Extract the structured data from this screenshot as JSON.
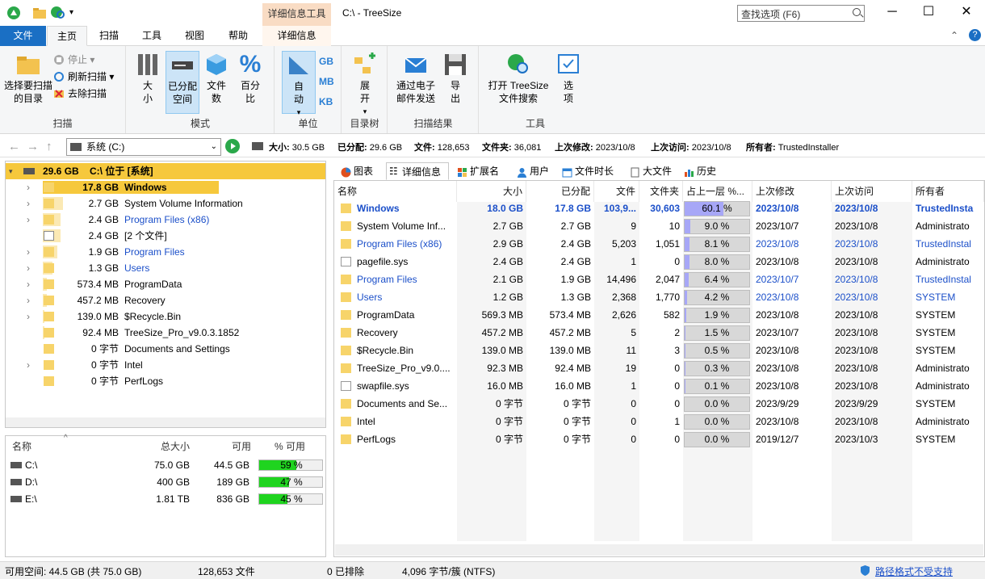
{
  "window": {
    "title": "C:\\ - TreeSize",
    "context_tab": "详细信息工具",
    "search_placeholder": "查找选项 (F6)"
  },
  "ribbon_tabs": [
    "文件",
    "主页",
    "扫描",
    "工具",
    "视图",
    "帮助",
    "详细信息"
  ],
  "ribbon": {
    "scan": {
      "select": "选择要扫描的目录",
      "stop": "停止",
      "refresh": "刷新扫描",
      "remove": "去除扫描",
      "group": "扫描"
    },
    "mode": {
      "size": "大小",
      "allocated": "已分配空间",
      "files": "文件数",
      "percent": "百分比",
      "group": "模式"
    },
    "unit": {
      "auto": "自动",
      "gb": "GB",
      "mb": "MB",
      "kb": "KB",
      "group": "单位"
    },
    "tree": {
      "expand": "展开",
      "group": "目录树"
    },
    "results": {
      "email": "通过电子邮件发送",
      "export": "导出",
      "group": "扫描结果"
    },
    "tools": {
      "search": "打开 TreeSize 文件搜索",
      "options": "选项",
      "group": "工具"
    }
  },
  "address": {
    "drive": "系统 (C:)",
    "stats": [
      {
        "label": "大小:",
        "value": "30.5 GB"
      },
      {
        "label": "已分配:",
        "value": "29.6 GB"
      },
      {
        "label": "文件:",
        "value": "128,653"
      },
      {
        "label": "文件夹:",
        "value": "36,081"
      },
      {
        "label": "上次修改:",
        "value": "2023/10/8"
      },
      {
        "label": "上次访问:",
        "value": "2023/10/8"
      },
      {
        "label": "所有者:",
        "value": "TrustedInstaller"
      }
    ]
  },
  "tree": {
    "root": {
      "size": "29.6 GB",
      "label": "C:\\  位于  [系统]"
    },
    "rows": [
      {
        "size": "17.8 GB",
        "name": "Windows",
        "bar": 100,
        "exp": true,
        "bold": true,
        "hl": true
      },
      {
        "size": "2.7 GB",
        "name": "System Volume Information",
        "bar": 15,
        "exp": true
      },
      {
        "size": "2.4 GB",
        "name": "Program Files (x86)",
        "bar": 13,
        "exp": true,
        "blue": true
      },
      {
        "size": "2.4 GB",
        "name": "[2 个文件]",
        "bar": 13,
        "exp": false,
        "file": true
      },
      {
        "size": "1.9 GB",
        "name": "Program Files",
        "bar": 11,
        "exp": true,
        "blue": true
      },
      {
        "size": "1.3 GB",
        "name": "Users",
        "bar": 7,
        "exp": true,
        "blue": true
      },
      {
        "size": "573.4 MB",
        "name": "ProgramData",
        "bar": 3,
        "exp": true
      },
      {
        "size": "457.2 MB",
        "name": "Recovery",
        "bar": 3,
        "exp": true
      },
      {
        "size": "139.0 MB",
        "name": "$Recycle.Bin",
        "bar": 1,
        "exp": true
      },
      {
        "size": "92.4 MB",
        "name": "TreeSize_Pro_v9.0.3.1852",
        "bar": 1,
        "exp": false
      },
      {
        "size": "0 字节",
        "name": "Documents and Settings",
        "bar": 0,
        "exp": false
      },
      {
        "size": "0 字节",
        "name": "Intel",
        "bar": 0,
        "exp": true
      },
      {
        "size": "0 字节",
        "name": "PerfLogs",
        "bar": 0,
        "exp": false
      }
    ]
  },
  "drives": {
    "headers": [
      "名称",
      "总大小",
      "可用",
      "% 可用"
    ],
    "rows": [
      {
        "name": "C:\\",
        "total": "75.0 GB",
        "free": "44.5 GB",
        "pct": 59,
        "pct_label": "59 %"
      },
      {
        "name": "D:\\",
        "total": "400 GB",
        "free": "189 GB",
        "pct": 47,
        "pct_label": "47 %"
      },
      {
        "name": "E:\\",
        "total": "1.81 TB",
        "free": "836 GB",
        "pct": 45,
        "pct_label": "45 %"
      }
    ]
  },
  "right_tabs": [
    "图表",
    "详细信息",
    "扩展名",
    "用户",
    "文件时长",
    "大文件",
    "历史"
  ],
  "grid": {
    "headers": [
      "名称",
      "大小",
      "已分配",
      "文件",
      "文件夹",
      "占上一层 %...",
      "上次修改",
      "上次访问",
      "所有者"
    ],
    "rows": [
      {
        "name": "Windows",
        "size": "18.0 GB",
        "alloc": "17.8 GB",
        "files": "103,9...",
        "folders": "30,603",
        "pct": 60.1,
        "pct_label": "60.1 %",
        "mod": "2023/10/8",
        "acc": "2023/10/8",
        "owner": "TrustedInsta",
        "bold": true,
        "blue": true
      },
      {
        "name": "System Volume Inf...",
        "size": "2.7 GB",
        "alloc": "2.7 GB",
        "files": "9",
        "folders": "10",
        "pct": 9.0,
        "pct_label": "9.0 %",
        "mod": "2023/10/7",
        "acc": "2023/10/8",
        "owner": "Administrato"
      },
      {
        "name": "Program Files (x86)",
        "size": "2.9 GB",
        "alloc": "2.4 GB",
        "files": "5,203",
        "folders": "1,051",
        "pct": 8.1,
        "pct_label": "8.1 %",
        "mod": "2023/10/8",
        "acc": "2023/10/8",
        "owner": "TrustedInstal",
        "blue": true
      },
      {
        "name": "pagefile.sys",
        "size": "2.4 GB",
        "alloc": "2.4 GB",
        "files": "1",
        "folders": "0",
        "pct": 8.0,
        "pct_label": "8.0 %",
        "mod": "2023/10/8",
        "acc": "2023/10/8",
        "owner": "Administrato",
        "file": true
      },
      {
        "name": "Program Files",
        "size": "2.1 GB",
        "alloc": "1.9 GB",
        "files": "14,496",
        "folders": "2,047",
        "pct": 6.4,
        "pct_label": "6.4 %",
        "mod": "2023/10/7",
        "acc": "2023/10/8",
        "owner": "TrustedInstal",
        "blue": true
      },
      {
        "name": "Users",
        "size": "1.2 GB",
        "alloc": "1.3 GB",
        "files": "2,368",
        "folders": "1,770",
        "pct": 4.2,
        "pct_label": "4.2 %",
        "mod": "2023/10/8",
        "acc": "2023/10/8",
        "owner": "SYSTEM",
        "blue": true
      },
      {
        "name": "ProgramData",
        "size": "569.3 MB",
        "alloc": "573.4 MB",
        "files": "2,626",
        "folders": "582",
        "pct": 1.9,
        "pct_label": "1.9 %",
        "mod": "2023/10/8",
        "acc": "2023/10/8",
        "owner": "SYSTEM"
      },
      {
        "name": "Recovery",
        "size": "457.2 MB",
        "alloc": "457.2 MB",
        "files": "5",
        "folders": "2",
        "pct": 1.5,
        "pct_label": "1.5 %",
        "mod": "2023/10/7",
        "acc": "2023/10/8",
        "owner": "SYSTEM"
      },
      {
        "name": "$Recycle.Bin",
        "size": "139.0 MB",
        "alloc": "139.0 MB",
        "files": "11",
        "folders": "3",
        "pct": 0.5,
        "pct_label": "0.5 %",
        "mod": "2023/10/8",
        "acc": "2023/10/8",
        "owner": "SYSTEM"
      },
      {
        "name": "TreeSize_Pro_v9.0....",
        "size": "92.3 MB",
        "alloc": "92.4 MB",
        "files": "19",
        "folders": "0",
        "pct": 0.3,
        "pct_label": "0.3 %",
        "mod": "2023/10/8",
        "acc": "2023/10/8",
        "owner": "Administrato"
      },
      {
        "name": "swapfile.sys",
        "size": "16.0 MB",
        "alloc": "16.0 MB",
        "files": "1",
        "folders": "0",
        "pct": 0.1,
        "pct_label": "0.1 %",
        "mod": "2023/10/8",
        "acc": "2023/10/8",
        "owner": "Administrato",
        "file": true
      },
      {
        "name": "Documents and Se...",
        "size": "0 字节",
        "alloc": "0 字节",
        "files": "0",
        "folders": "0",
        "pct": 0,
        "pct_label": "0.0 %",
        "mod": "2023/9/29",
        "acc": "2023/9/29",
        "owner": "SYSTEM"
      },
      {
        "name": "Intel",
        "size": "0 字节",
        "alloc": "0 字节",
        "files": "0",
        "folders": "1",
        "pct": 0,
        "pct_label": "0.0 %",
        "mod": "2023/10/8",
        "acc": "2023/10/8",
        "owner": "Administrato"
      },
      {
        "name": "PerfLogs",
        "size": "0 字节",
        "alloc": "0 字节",
        "files": "0",
        "folders": "0",
        "pct": 0,
        "pct_label": "0.0 %",
        "mod": "2019/12/7",
        "acc": "2023/10/3",
        "owner": "SYSTEM"
      }
    ]
  },
  "status": {
    "free": "可用空间: 44.5 GB  (共 75.0 GB)",
    "files": "128,653 文件",
    "excluded": "0 已排除",
    "cluster": "4,096 字节/簇 (NTFS)",
    "path": "路径格式不受支持"
  },
  "colors": {
    "accent": "#1a6fc4",
    "tree_highlight": "#f6c83c",
    "bar": "#fbe9b4",
    "pct_fill": "#a7a7f7",
    "drive_fill": "#1fd41f"
  }
}
